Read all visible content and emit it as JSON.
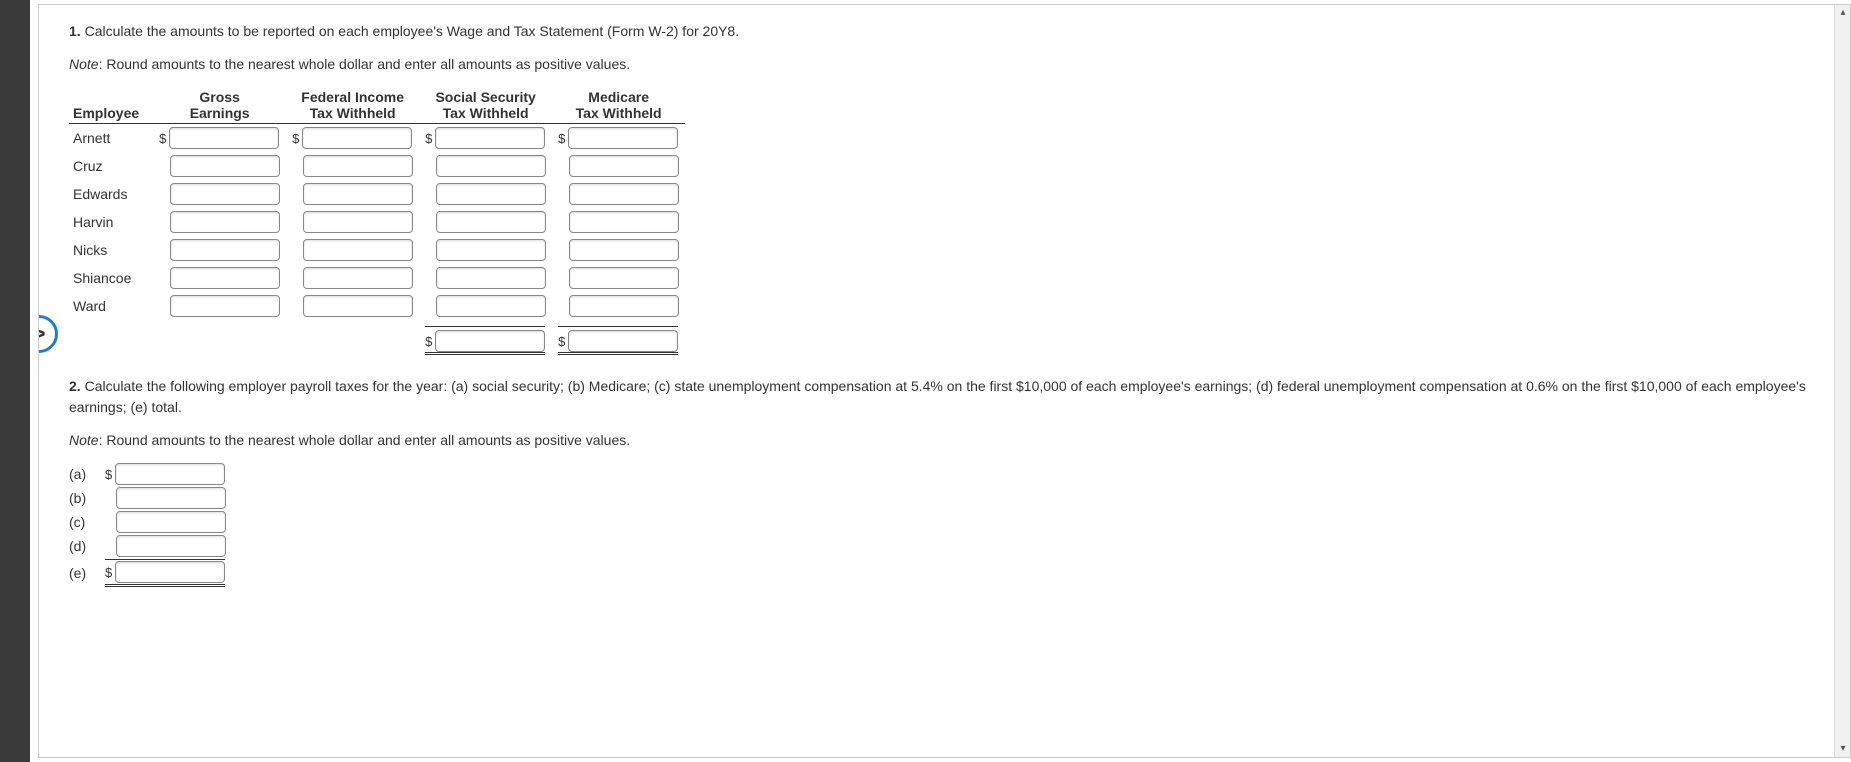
{
  "q1": {
    "number": "1.",
    "text": "Calculate the amounts to be reported on each employee's Wage and Tax Statement (Form W-2) for 20Y8.",
    "note_label": "Note",
    "note_text": ": Round amounts to the nearest whole dollar and enter all amounts as positive values."
  },
  "table": {
    "headers": {
      "employee": "Employee",
      "gross": "Gross\nEarnings",
      "federal": "Federal Income\nTax Withheld",
      "ss": "Social Security\nTax Withheld",
      "medicare": "Medicare\nTax Withheld"
    },
    "employees": [
      {
        "name": "Arnett"
      },
      {
        "name": "Cruz"
      },
      {
        "name": "Edwards"
      },
      {
        "name": "Harvin"
      },
      {
        "name": "Nicks"
      },
      {
        "name": "Shiancoe"
      },
      {
        "name": "Ward"
      }
    ],
    "dollar": "$"
  },
  "q2": {
    "number": "2.",
    "text": "Calculate the following employer payroll taxes for the year: (a) social security; (b) Medicare; (c) state unemployment compensation at 5.4% on the first $10,000 of each employee's earnings; (d) federal unemployment compensation at 0.6% on the first $10,000 of each employee's earnings; (e) total.",
    "note_label": "Note",
    "note_text": ": Round amounts to the nearest whole dollar and enter all amounts as positive values.",
    "rows": [
      {
        "label": "(a)",
        "dollar": true
      },
      {
        "label": "(b)",
        "dollar": false
      },
      {
        "label": "(c)",
        "dollar": false
      },
      {
        "label": "(d)",
        "dollar": false
      },
      {
        "label": "(e)",
        "dollar": true,
        "total": true
      }
    ]
  },
  "nav": {
    "next_glyph": ">"
  },
  "scroll": {
    "up": "▴",
    "down": "▾"
  }
}
